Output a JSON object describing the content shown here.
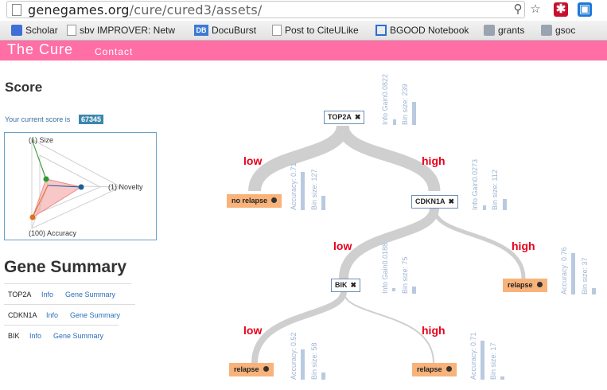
{
  "browser": {
    "url_host": "genegames.org",
    "url_path": "/cure/cured3/assets/",
    "bookmarks": [
      {
        "label": "Scholar",
        "icon": "scholar-icon"
      },
      {
        "label": "sbv IMPROVER: Netw",
        "icon": "doc-icon"
      },
      {
        "label": "DocuBurst",
        "icon": "db-icon"
      },
      {
        "label": "Post to CiteULike",
        "icon": "doc-icon"
      },
      {
        "label": "BGOOD Notebook",
        "icon": "notebook-icon"
      },
      {
        "label": "grants",
        "icon": "folder-icon"
      },
      {
        "label": "gsoc",
        "icon": "folder-icon"
      }
    ]
  },
  "app": {
    "brand": "The Cure",
    "nav_contact": "Contact"
  },
  "score": {
    "heading": "Score",
    "text": "Your current score is",
    "value": "67345",
    "radar_labels": {
      "size": "(1) Size",
      "novelty": "(1) Novelty",
      "accuracy": "(100) Accuracy"
    }
  },
  "gene_summary": {
    "heading": "Gene Summary",
    "rows": [
      {
        "gene": "TOP2A",
        "info": "Info",
        "summary": "Gene Summary"
      },
      {
        "gene": "CDKN1A",
        "info": "Info",
        "summary": "Gene Summary"
      },
      {
        "gene": "BIK",
        "info": "Info",
        "summary": "Gene Summary"
      }
    ]
  },
  "tree": {
    "nodes": [
      {
        "gene": "TOP2A",
        "info_gain": "Info Gain0.0822",
        "bin_size": "Bin size: 239"
      },
      {
        "gene": "CDKN1A",
        "info_gain": "Info Gain0.0273",
        "bin_size": "Bin size: 112"
      },
      {
        "gene": "BIK",
        "info_gain": "Info Gain0.0188",
        "bin_size": "Bin size: 75"
      }
    ],
    "leaves": [
      {
        "label": "no relapse",
        "accuracy": "Accuracy: 0.71",
        "bin_size": "Bin size: 127"
      },
      {
        "label": "relapse",
        "accuracy": "Accuracy: 0.76",
        "bin_size": "Bin size: 37"
      },
      {
        "label": "relapse",
        "accuracy": "Accuracy: 0.52",
        "bin_size": "Bin size: 58"
      },
      {
        "label": "relapse",
        "accuracy": "Accuracy: 0.71",
        "bin_size": "Bin size: 17"
      }
    ],
    "branch_low": "low",
    "branch_high": "high"
  }
}
